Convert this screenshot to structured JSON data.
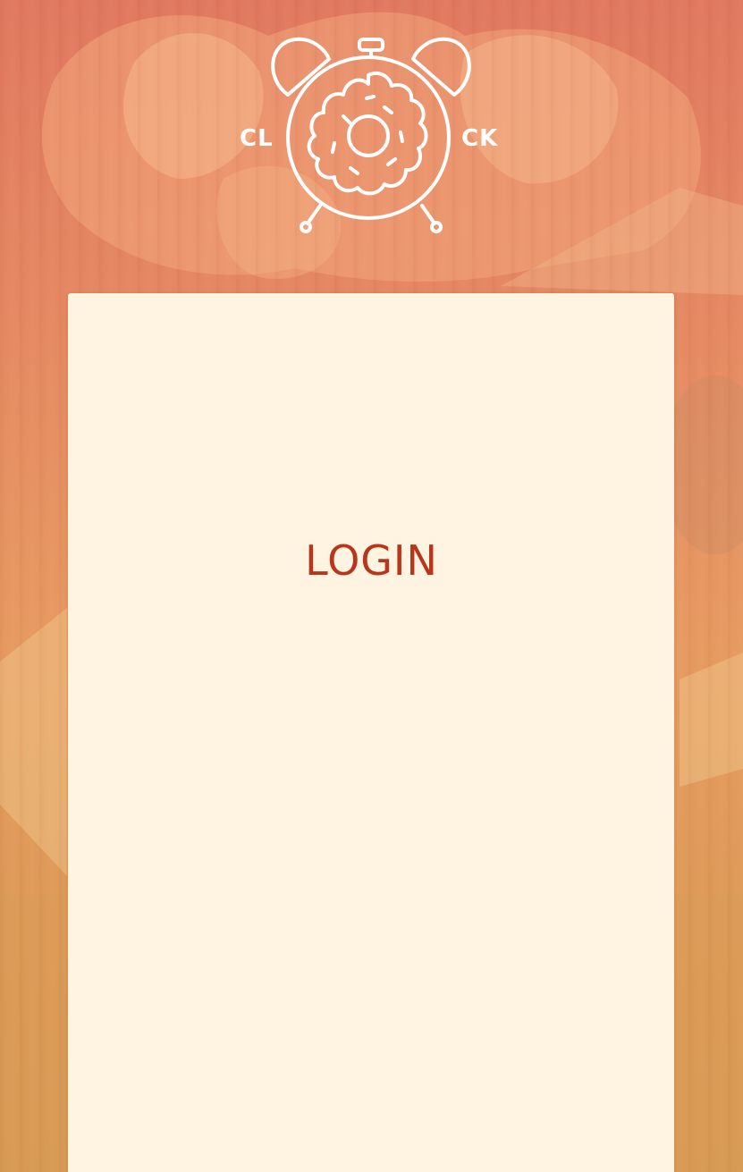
{
  "logo": {
    "left_text": "CL",
    "right_text": "CK",
    "icon": "alarm-clock-donut-icon"
  },
  "login": {
    "title": "LOGIN"
  },
  "colors": {
    "title_red": "#b8361c",
    "card_bg": "#fff3e1",
    "bg_top": "#e0785f",
    "bg_bottom": "#d79a55"
  }
}
